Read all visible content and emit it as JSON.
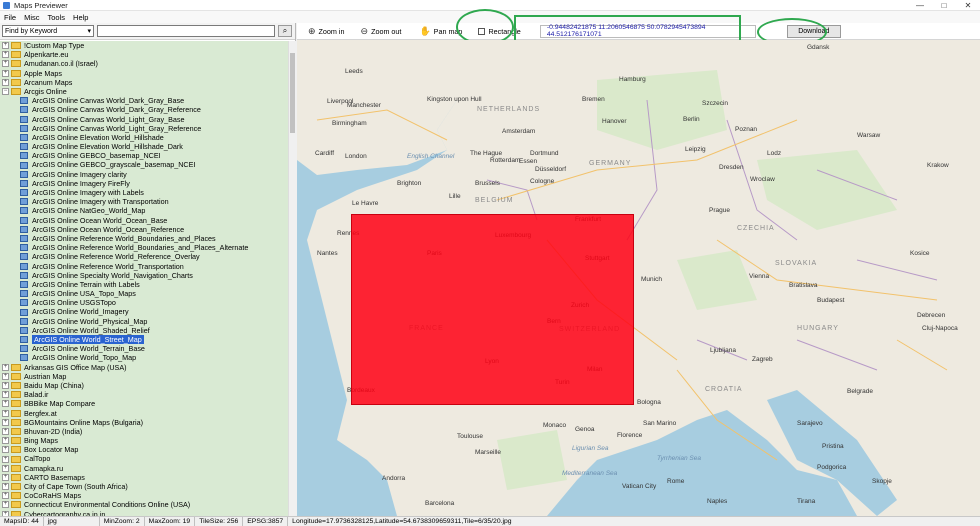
{
  "window": {
    "title": "Maps Previewer",
    "controls": [
      "—",
      "□",
      "✕"
    ]
  },
  "menu": [
    "File",
    "Misc",
    "Tools",
    "Help"
  ],
  "search": {
    "type_value": "Find by Keyword",
    "input_value": "",
    "button_icon": "search-icon"
  },
  "tree": [
    {
      "label": "!Custom Map Type",
      "kind": "folder",
      "expanded": false
    },
    {
      "label": "Alpenkarte.eu",
      "kind": "folder",
      "expanded": false
    },
    {
      "label": "Amudanan.co.il (Israel)",
      "kind": "folder",
      "expanded": false
    },
    {
      "label": "Apple Maps",
      "kind": "folder",
      "expanded": false
    },
    {
      "label": "Arcanum Maps",
      "kind": "folder",
      "expanded": false
    },
    {
      "label": "Arcgis Online",
      "kind": "folder",
      "expanded": true
    },
    {
      "label": "ArcGIS Online Canvas World_Dark_Gray_Base",
      "kind": "layer"
    },
    {
      "label": "ArcGIS Online Canvas World_Dark_Gray_Reference",
      "kind": "layer"
    },
    {
      "label": "ArcGIS Online Canvas World_Light_Gray_Base",
      "kind": "layer"
    },
    {
      "label": "ArcGIS Online Canvas World_Light_Gray_Reference",
      "kind": "layer"
    },
    {
      "label": "ArcGIS Online Elevation World_Hillshade",
      "kind": "layer"
    },
    {
      "label": "ArcGIS Online Elevation World_Hillshade_Dark",
      "kind": "layer"
    },
    {
      "label": "ArcGIS Online GEBCO_basemap_NCEI",
      "kind": "layer"
    },
    {
      "label": "ArcGIS Online GEBCO_grayscale_basemap_NCEI",
      "kind": "layer"
    },
    {
      "label": "ArcGIS Online Imagery clarity",
      "kind": "layer"
    },
    {
      "label": "ArcGIS Online Imagery FireFly",
      "kind": "layer"
    },
    {
      "label": "ArcGIS Online Imagery with Labels",
      "kind": "layer"
    },
    {
      "label": "ArcGIS Online Imagery with Transportation",
      "kind": "layer"
    },
    {
      "label": "ArcGIS Online NatGeo_World_Map",
      "kind": "layer"
    },
    {
      "label": "ArcGIS Online Ocean World_Ocean_Base",
      "kind": "layer"
    },
    {
      "label": "ArcGIS Online Ocean World_Ocean_Reference",
      "kind": "layer"
    },
    {
      "label": "ArcGIS Online Reference World_Boundaries_and_Places",
      "kind": "layer"
    },
    {
      "label": "ArcGIS Online Reference World_Boundaries_and_Places_Alternate",
      "kind": "layer"
    },
    {
      "label": "ArcGIS Online Reference World_Reference_Overlay",
      "kind": "layer"
    },
    {
      "label": "ArcGIS Online Reference World_Transportation",
      "kind": "layer"
    },
    {
      "label": "ArcGIS Online Specialty World_Navigation_Charts",
      "kind": "layer"
    },
    {
      "label": "ArcGIS Online Terrain with Labels",
      "kind": "layer"
    },
    {
      "label": "ArcGIS Online USA_Topo_Maps",
      "kind": "layer"
    },
    {
      "label": "ArcGIS Online USGSTopo",
      "kind": "layer"
    },
    {
      "label": "ArcGIS Online World_Imagery",
      "kind": "layer"
    },
    {
      "label": "ArcGIS Online World_Physical_Map",
      "kind": "layer"
    },
    {
      "label": "ArcGIS Online World_Shaded_Relief",
      "kind": "layer"
    },
    {
      "label": "ArcGIS Online World_Street_Map",
      "kind": "layer",
      "selected": true
    },
    {
      "label": "ArcGIS Online World_Terrain_Base",
      "kind": "layer"
    },
    {
      "label": "ArcGIS Online World_Topo_Map",
      "kind": "layer"
    },
    {
      "label": "Arkansas GIS Office Map (USA)",
      "kind": "folder",
      "expanded": false
    },
    {
      "label": "Austrian Map",
      "kind": "folder",
      "expanded": false
    },
    {
      "label": "Baidu Map (China)",
      "kind": "folder",
      "expanded": false
    },
    {
      "label": "Balad.ir",
      "kind": "folder",
      "expanded": false
    },
    {
      "label": "BBBike Map Compare",
      "kind": "folder",
      "expanded": false
    },
    {
      "label": "Bergfex.at",
      "kind": "folder",
      "expanded": false
    },
    {
      "label": "BGMountains Online Maps (Bulgaria)",
      "kind": "folder",
      "expanded": false
    },
    {
      "label": "Bhuvan-2D (India)",
      "kind": "folder",
      "expanded": false
    },
    {
      "label": "Bing Maps",
      "kind": "folder",
      "expanded": false
    },
    {
      "label": "Box Locator Map",
      "kind": "folder",
      "expanded": false
    },
    {
      "label": "CalTopo",
      "kind": "folder",
      "expanded": false
    },
    {
      "label": "Camapka.ru",
      "kind": "folder",
      "expanded": false
    },
    {
      "label": "CARTO Basemaps",
      "kind": "folder",
      "expanded": false
    },
    {
      "label": "City of Cape Town (South Africa)",
      "kind": "folder",
      "expanded": false
    },
    {
      "label": "CoCoRaHS Maps",
      "kind": "folder",
      "expanded": false
    },
    {
      "label": "Connecticut Environmental Conditions Online (USA)",
      "kind": "folder",
      "expanded": false
    },
    {
      "label": "Cybercartography.ca.in.in",
      "kind": "folder",
      "expanded": false
    }
  ],
  "toolbar": {
    "zoom_in": "Zoom in",
    "zoom_out": "Zoom out",
    "pan_map": "Pan map",
    "rectangle": "Rectangle",
    "coords": "-0.94482421875   11.2060546875   50.0782945473894   44.512176171071",
    "download": "Download"
  },
  "map": {
    "labels": [
      {
        "text": "Leeds",
        "type": "city"
      },
      {
        "text": "Liverpool",
        "type": "city"
      },
      {
        "text": "Manchester",
        "type": "city"
      },
      {
        "text": "Kingston upon Hull",
        "type": "city"
      },
      {
        "text": "Birmingham",
        "type": "city"
      },
      {
        "text": "Cardiff",
        "type": "city"
      },
      {
        "text": "London",
        "type": "city"
      },
      {
        "text": "Brighton",
        "type": "city"
      },
      {
        "text": "English Channel",
        "type": "sea"
      },
      {
        "text": "NETHERLANDS",
        "type": "country"
      },
      {
        "text": "Amsterdam",
        "type": "city"
      },
      {
        "text": "The Hague",
        "type": "city"
      },
      {
        "text": "Rotterdam",
        "type": "city"
      },
      {
        "text": "Brussels",
        "type": "city"
      },
      {
        "text": "BELGIUM",
        "type": "country"
      },
      {
        "text": "Lille",
        "type": "city"
      },
      {
        "text": "Hamburg",
        "type": "city"
      },
      {
        "text": "Bremen",
        "type": "city"
      },
      {
        "text": "Hanover",
        "type": "city"
      },
      {
        "text": "Berlin",
        "type": "city"
      },
      {
        "text": "Dortmund",
        "type": "city"
      },
      {
        "text": "Essen",
        "type": "city"
      },
      {
        "text": "Düsseldorf",
        "type": "city"
      },
      {
        "text": "Cologne",
        "type": "city"
      },
      {
        "text": "GERMANY",
        "type": "country"
      },
      {
        "text": "Leipzig",
        "type": "city"
      },
      {
        "text": "Dresden",
        "type": "city"
      },
      {
        "text": "Frankfurt",
        "type": "city"
      },
      {
        "text": "Luxembourg",
        "type": "city"
      },
      {
        "text": "Paris",
        "type": "city"
      },
      {
        "text": "Stuttgart",
        "type": "city"
      },
      {
        "text": "Munich",
        "type": "city"
      },
      {
        "text": "FRANCE",
        "type": "country"
      },
      {
        "text": "Zurich",
        "type": "city"
      },
      {
        "text": "Bern",
        "type": "city"
      },
      {
        "text": "SWITZERLAND",
        "type": "country"
      },
      {
        "text": "Lyon",
        "type": "city"
      },
      {
        "text": "Milan",
        "type": "city"
      },
      {
        "text": "Turin",
        "type": "city"
      },
      {
        "text": "Bordeaux",
        "type": "city"
      },
      {
        "text": "Toulouse",
        "type": "city"
      },
      {
        "text": "Marseille",
        "type": "city"
      },
      {
        "text": "Monaco",
        "type": "city"
      },
      {
        "text": "Genoa",
        "type": "city"
      },
      {
        "text": "Bologna",
        "type": "city"
      },
      {
        "text": "Florence",
        "type": "city"
      },
      {
        "text": "San Marino",
        "type": "city"
      },
      {
        "text": "Ligurian Sea",
        "type": "sea"
      },
      {
        "text": "Prague",
        "type": "city"
      },
      {
        "text": "CZECHIA",
        "type": "country"
      },
      {
        "text": "Vienna",
        "type": "city"
      },
      {
        "text": "Bratislava",
        "type": "city"
      },
      {
        "text": "SLOVAKIA",
        "type": "country"
      },
      {
        "text": "Budapest",
        "type": "city"
      },
      {
        "text": "HUNGARY",
        "type": "country"
      },
      {
        "text": "Ljubljana",
        "type": "city"
      },
      {
        "text": "Zagreb",
        "type": "city"
      },
      {
        "text": "CROATIA",
        "type": "country"
      },
      {
        "text": "Belgrade",
        "type": "city"
      },
      {
        "text": "Sarajevo",
        "type": "city"
      },
      {
        "text": "Warsaw",
        "type": "city"
      },
      {
        "text": "Krakow",
        "type": "city"
      },
      {
        "text": "Gdansk",
        "type": "city"
      },
      {
        "text": "Wroclaw",
        "type": "city"
      },
      {
        "text": "Lodz",
        "type": "city"
      },
      {
        "text": "Poznan",
        "type": "city"
      },
      {
        "text": "Szczecin",
        "type": "city"
      },
      {
        "text": "Kosice",
        "type": "city"
      },
      {
        "text": "Debrecen",
        "type": "city"
      },
      {
        "text": "Cluj-Napoca",
        "type": "city"
      },
      {
        "text": "Rome",
        "type": "city"
      },
      {
        "text": "Vatican City",
        "type": "city"
      },
      {
        "text": "Naples",
        "type": "city"
      },
      {
        "text": "Barcelona",
        "type": "city"
      },
      {
        "text": "Andorra",
        "type": "city"
      },
      {
        "text": "Mediterranean Sea",
        "type": "sea"
      },
      {
        "text": "Tyrrhenian Sea",
        "type": "sea"
      },
      {
        "text": "Podgorica",
        "type": "city"
      },
      {
        "text": "Skopje",
        "type": "city"
      },
      {
        "text": "Tirana",
        "type": "city"
      },
      {
        "text": "Pristina",
        "type": "city"
      },
      {
        "text": "Nantes",
        "type": "city"
      },
      {
        "text": "Rennes",
        "type": "city"
      },
      {
        "text": "Le Havre",
        "type": "city"
      }
    ]
  },
  "status": {
    "maps_id": "MapsID: 44",
    "format": "jpg",
    "min_zoom": "MinZoom: 2",
    "max_zoom": "MaxZoom: 19",
    "tile_size": "TileSize: 256",
    "epsg": "EPSG:3857",
    "position": "Longitude=17.9736328125,Latitude=54.6738309659311,Tile=6/35/20.jpg"
  },
  "colors": {
    "selection": "#ff0014",
    "highlight": "#2fa84f",
    "tree_bg": "#d9ead3",
    "selected_item": "#2a63d0"
  }
}
